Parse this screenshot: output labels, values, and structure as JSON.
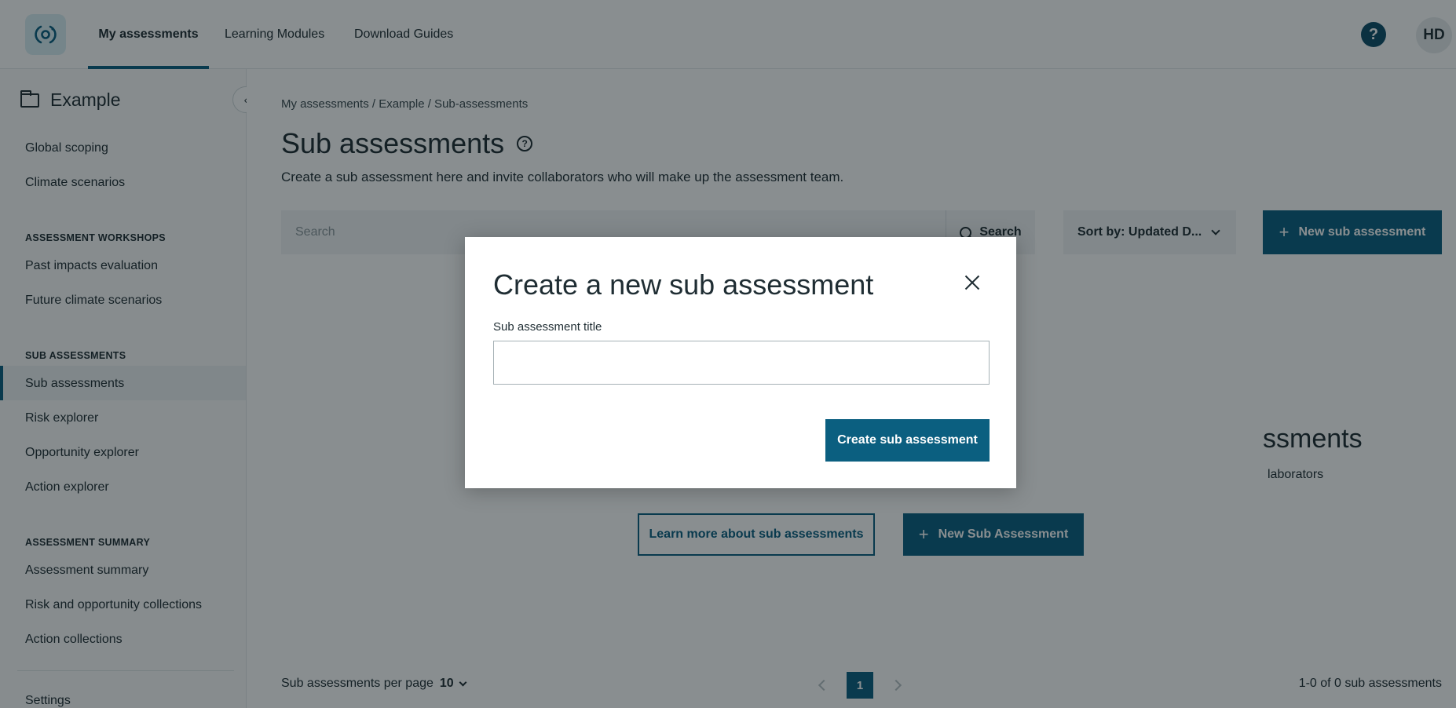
{
  "topnav": {
    "tabs": [
      "My assessments",
      "Learning Modules",
      "Download Guides"
    ],
    "help_label": "?",
    "avatar_initials": "HD"
  },
  "sidebar": {
    "title": "Example",
    "items": {
      "global_scoping": "Global scoping",
      "climate_scenarios": "Climate scenarios",
      "section_workshops": "ASSESSMENT WORKSHOPS",
      "past_impacts": "Past impacts evaluation",
      "future_climate": "Future climate scenarios",
      "section_sub": "SUB ASSESSMENTS",
      "sub_assessments": "Sub assessments",
      "risk_explorer": "Risk explorer",
      "opportunity_explorer": "Opportunity explorer",
      "action_explorer": "Action explorer",
      "section_summary": "ASSESSMENT SUMMARY",
      "assessment_summary": "Assessment summary",
      "risk_opp_collections": "Risk and opportunity collections",
      "action_collections": "Action collections",
      "settings": "Settings"
    },
    "collapse_icon": "‹"
  },
  "main": {
    "breadcrumb": "My assessments / Example / Sub-assessments",
    "title": "Sub assessments",
    "title_help": "?",
    "description": "Create a sub assessment here and invite collaborators who will make up the assessment team.",
    "search_placeholder": "Search",
    "search_button": "Search",
    "sort_label": "Sort by: Updated D...",
    "new_button": "New sub assessment",
    "empty_title_visible": "ssments",
    "empty_desc_visible": "laborators",
    "learn_more_button": "Learn more about sub assessments",
    "new_sub_button": "New Sub Assessment",
    "per_page_label": "Sub assessments per page",
    "per_page_value": "10",
    "current_page": "1",
    "results": "1-0 of 0 sub assessments"
  },
  "modal": {
    "title": "Create a new sub assessment",
    "field_label": "Sub assessment title",
    "field_value": "",
    "submit_label": "Create sub assessment"
  },
  "colors": {
    "primary": "#0b5f80",
    "overlay": "rgba(8,18,24,0.48)"
  }
}
